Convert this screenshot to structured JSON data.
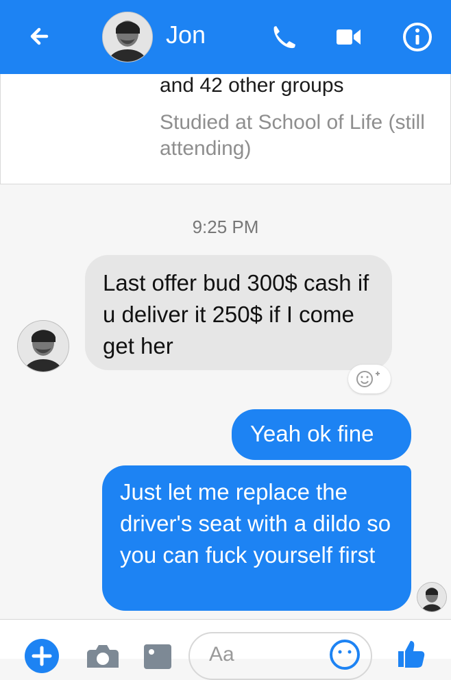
{
  "header": {
    "title": "Jon",
    "icons": [
      "back-arrow-icon",
      "phone-icon",
      "video-icon",
      "info-icon"
    ],
    "colors": {
      "accent": "#1d83f3"
    }
  },
  "profile": {
    "groups": "and 42 other groups",
    "studied": "Studied at School of Life (still attending)"
  },
  "conversation": {
    "timestamp": "9:25 PM",
    "incoming": "Last offer bud 300$ cash if u deliver it 250$ if I come get her",
    "outgoing": [
      "Yeah ok fine",
      "Just let me replace the driver's seat with a dildo so you can fuck yourself first"
    ]
  },
  "composer": {
    "placeholder": "Aa",
    "icons": [
      "plus-icon",
      "camera-icon",
      "gallery-icon",
      "emoji-icon",
      "like-icon"
    ]
  }
}
